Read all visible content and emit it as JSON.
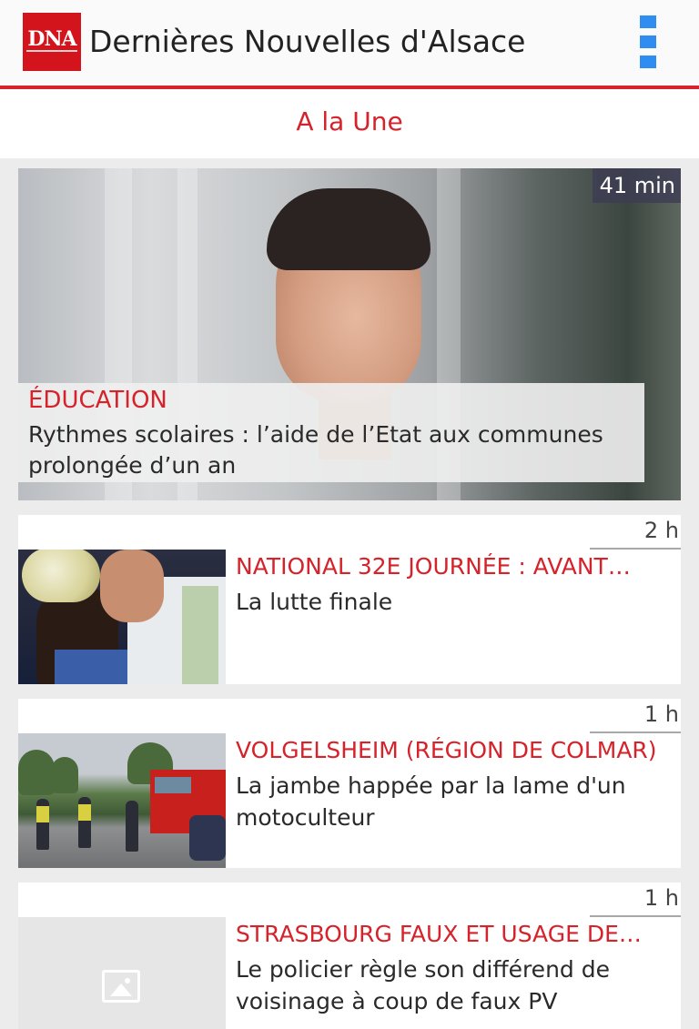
{
  "app": {
    "logo_text": "DNA",
    "title": "Dernières Nouvelles d'Alsace",
    "menu_icon": "overflow-menu-icon",
    "accent_color": "#d6222a",
    "menu_color": "#2f8cf0"
  },
  "section": {
    "title": "A la Une"
  },
  "hero": {
    "time": "41 min",
    "category": "ÉDUCATION",
    "title": "Rythmes scolaires : l’aide de l’Etat aux communes prolongée d’un an",
    "image": "portrait-photo"
  },
  "articles": [
    {
      "time": "2 h",
      "category": "NATIONAL 32E JOURNÉE : AVANT…",
      "title": "La lutte finale",
      "image": "football-photo"
    },
    {
      "time": "1 h",
      "category": "VOLGELSHEIM (RÉGION DE COLMAR)",
      "title": "La jambe happée par la lame d'un motoculteur",
      "image": "firefighters-photo"
    },
    {
      "time": "1 h",
      "category": "STRASBOURG FAUX ET USAGE DE…",
      "title": "Le policier règle son différend de voisinage à coup de faux PV",
      "image": "image-placeholder-icon"
    }
  ]
}
